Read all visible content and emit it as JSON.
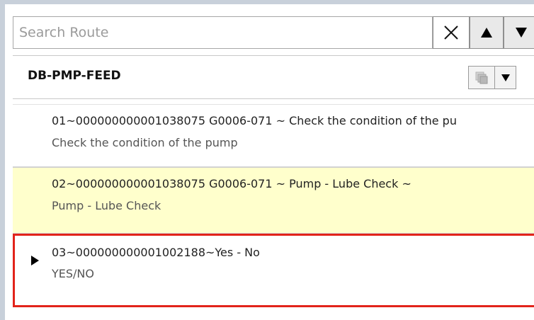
{
  "search": {
    "placeholder": "Search Route",
    "value": ""
  },
  "icons": {
    "clear": "close-icon",
    "up": "arrow-up-icon",
    "down": "arrow-down-icon",
    "copy": "copy-icon",
    "dropdown": "chevron-down-icon",
    "current": "current-row-indicator"
  },
  "route": {
    "title": "DB-PMP-FEED"
  },
  "items": [
    {
      "line1": "01~000000000001038075 G0006-071 ~ Check the condition of the pu",
      "line2": "Check the condition of the pump",
      "state": "normal"
    },
    {
      "line1": "02~000000000001038075 G0006-071 ~ Pump - Lube Check ~",
      "line2": "Pump - Lube Check",
      "state": "highlighted"
    },
    {
      "line1": "03~000000000001002188~Yes - No",
      "line2": "YES/NO",
      "state": "selected-current"
    }
  ],
  "colors": {
    "highlight_bg": "#ffffcc",
    "selection_border": "#e2231a",
    "frame": "#c8d0da"
  }
}
